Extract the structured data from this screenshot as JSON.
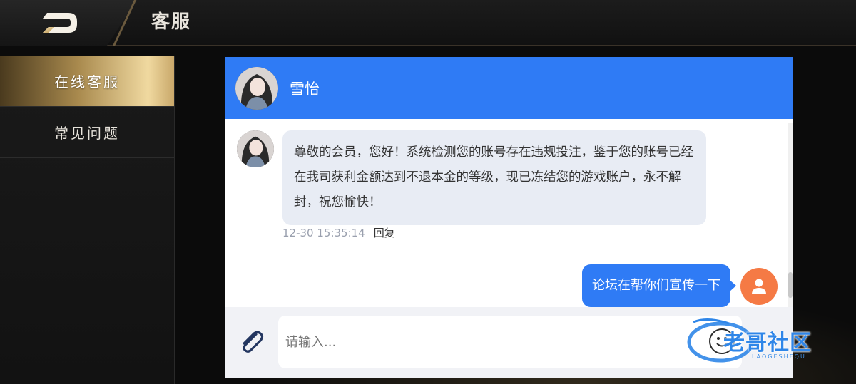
{
  "header": {
    "title": "客服"
  },
  "sidebar": {
    "items": [
      {
        "label": "在线客服",
        "active": true
      },
      {
        "label": "常见问题",
        "active": false
      }
    ]
  },
  "chat": {
    "agent_name": "雪怡",
    "messages": [
      {
        "direction": "incoming",
        "text": "尊敬的会员，您好！系统检测您的账号存在违规投注，鉴于您的账号已经在我司获利金额达到不退本金的等级，现已冻结您的游戏账户，永不解封，祝您愉快！",
        "timestamp": "12-30 15:35:14",
        "reply_label": "回复"
      },
      {
        "direction": "outgoing",
        "text": "论坛在帮你们宣传一下"
      }
    ],
    "input": {
      "placeholder": "请输入...",
      "value": ""
    }
  },
  "watermark": {
    "text": "老哥社区",
    "sub": "LAOGESHEQU"
  },
  "colors": {
    "accent": "#2f7bf5",
    "bubble_in": "#e8ecf4",
    "user_avatar": "#f57a45",
    "gold": "#c9a86a"
  },
  "icons": [
    "back-arrow-icon",
    "paperclip-icon",
    "emoji-icon",
    "user-icon"
  ]
}
